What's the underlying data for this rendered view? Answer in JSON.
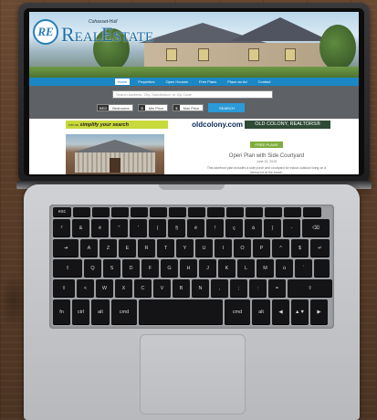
{
  "site": {
    "logo_badge": "RE",
    "logo_small": "Cohasset-Hull",
    "logo_main": "RealEstate"
  },
  "nav": [
    "Home",
    "Properties",
    "Open Houses",
    "Free Plans",
    "Place an Ad",
    "Contact"
  ],
  "search": {
    "placeholder": "Search Address, City, Subdivision, or Zip Code",
    "bedrooms": {
      "label": "BED",
      "value": "Bedrooms"
    },
    "min_price": {
      "label": "$",
      "value": "Min Price"
    },
    "max_price": {
      "label": "$",
      "value": "Max Price"
    },
    "button": "SEARCH"
  },
  "ads": {
    "ad1_pre": "Let us",
    "ad1": "simplify your search",
    "ad2": "oldcolony.com",
    "ad3": "OLD COLONY, REALTORS®"
  },
  "listing": {
    "badge": "FREE PLANS",
    "title": "Open Plan with Side Courtyard",
    "date": "June 13, 2019",
    "desc": "This lakefront plan includes a side porch and courtyard for indoor-outdoor living on a narrow lot at the beach."
  },
  "keyboard": {
    "row0": [
      "esc",
      "",
      "",
      "",
      "",
      "",
      "",
      "",
      "",
      "",
      "",
      "",
      "",
      ""
    ],
    "row1": [
      "²",
      "&",
      "é",
      "\"",
      "'",
      "(",
      "§",
      "è",
      "!",
      "ç",
      "à",
      ")",
      "-",
      "⌫"
    ],
    "row2": [
      "⇥",
      "A",
      "Z",
      "E",
      "R",
      "T",
      "Y",
      "U",
      "I",
      "O",
      "P",
      "^",
      "$",
      "↵"
    ],
    "row3": [
      "⇪",
      "Q",
      "S",
      "D",
      "F",
      "G",
      "H",
      "J",
      "K",
      "L",
      "M",
      "ù",
      "`",
      ""
    ],
    "row4": [
      "⇧",
      "<",
      "W",
      "X",
      "C",
      "V",
      "B",
      "N",
      ",",
      ";",
      ":",
      "=",
      "⇧"
    ],
    "row5": [
      "fn",
      "ctrl",
      "alt",
      "cmd",
      "",
      "cmd",
      "alt",
      "◀",
      "▲▼",
      "▶"
    ]
  }
}
